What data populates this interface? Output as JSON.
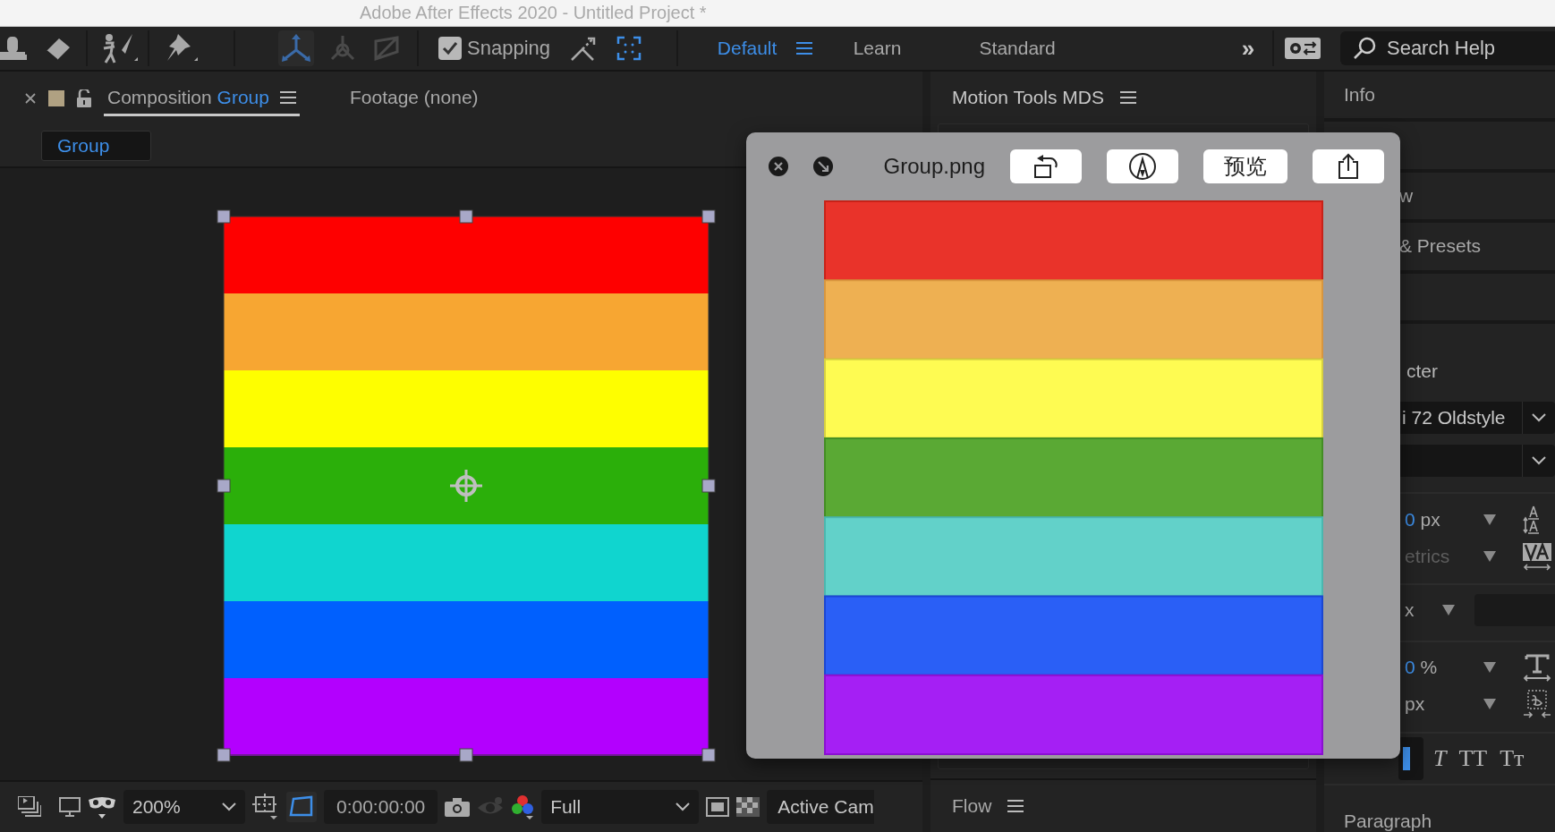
{
  "window": {
    "title": "Adobe After Effects 2020 - Untitled Project *"
  },
  "toolbar": {
    "snapping": {
      "label": "Snapping",
      "checked": true
    },
    "workspaces": [
      {
        "label": "Default",
        "selected": true
      },
      {
        "label": "Learn",
        "selected": false
      },
      {
        "label": "Standard",
        "selected": false
      }
    ],
    "overflow": "»",
    "search": {
      "placeholder": "Search Help"
    }
  },
  "composition_panel": {
    "tabs": [
      {
        "prefix": "Composition",
        "name": "Group",
        "selected": true
      },
      {
        "prefix": "Footage (none)",
        "selected": false
      }
    ],
    "breadcrumb": "Group",
    "zoom": "200%",
    "timecode": "0:00:00:00",
    "resolution": "Full",
    "camera": "Active Cam"
  },
  "motion_tools_panel": {
    "title": "Motion Tools MDS"
  },
  "flow_panel": {
    "title": "Flow"
  },
  "preview_window": {
    "title": "Group.png",
    "buttons": [
      {
        "kind": "rotate"
      },
      {
        "kind": "markup"
      },
      {
        "kind": "text",
        "label": "预览"
      },
      {
        "kind": "share"
      }
    ]
  },
  "right_panel": {
    "title": "Info",
    "sections": [
      "w",
      "& Presets"
    ],
    "character": {
      "title": "cter",
      "font_family": "i 72 Oldstyle",
      "size_value": "0",
      "size_unit": "px",
      "kerning": "etrics",
      "tracking_unit": "x",
      "scale_value": "0",
      "scale_unit": "%",
      "baseline_unit": "px",
      "styles": [
        {
          "kind": "bold",
          "selected": true
        },
        {
          "kind": "italic",
          "label": "T",
          "selected": false
        },
        {
          "kind": "caps",
          "label": "TT",
          "selected": false
        },
        {
          "kind": "smallcaps",
          "label": "Tᴛ",
          "selected": false
        }
      ]
    },
    "paragraph_title": "Paragraph"
  }
}
